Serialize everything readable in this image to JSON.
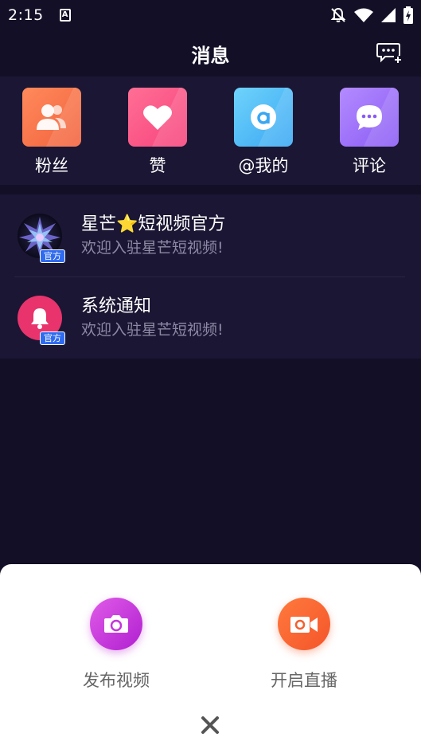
{
  "status_bar": {
    "time": "2:15",
    "a_icon": "A",
    "icons": [
      "notifications-off-icon",
      "wifi-icon",
      "signal-icon",
      "battery-charging-icon"
    ]
  },
  "header": {
    "title": "消息",
    "action_icon": "new-message-icon"
  },
  "quick_actions": [
    {
      "label": "粉丝",
      "icon": "fans-icon",
      "color": "#f46a45"
    },
    {
      "label": "赞",
      "icon": "heart-icon",
      "color": "#f7437c"
    },
    {
      "label": "@我的",
      "icon": "at-icon",
      "color": "#3aa7f3"
    },
    {
      "label": "评论",
      "icon": "comment-icon",
      "color": "#8a5bf4"
    }
  ],
  "messages": [
    {
      "title": "星芒⭐短视频官方",
      "subtitle": "欢迎入驻星芒短视频!",
      "badge": "官方",
      "avatar_icon": "star-burst-avatar"
    },
    {
      "title": "系统通知",
      "subtitle": "欢迎入驻星芒短视频!",
      "badge": "官方",
      "avatar_icon": "bell-icon"
    }
  ],
  "sheet": {
    "publish_label": "发布视频",
    "live_label": "开启直播",
    "close_icon": "close-icon"
  }
}
